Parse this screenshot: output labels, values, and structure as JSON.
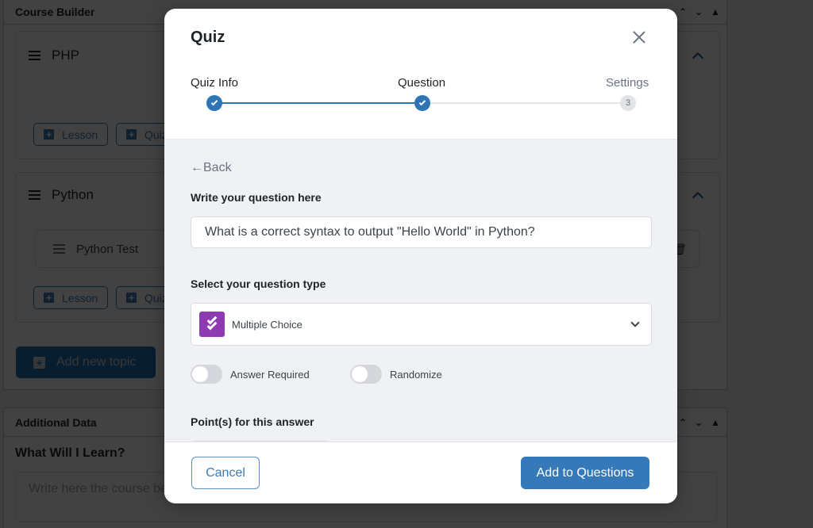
{
  "background": {
    "course_builder": {
      "title": "Course Builder",
      "topics": [
        {
          "name": "PHP",
          "items": [],
          "buttons": [
            "Lesson",
            "Quiz"
          ]
        },
        {
          "name": "Python",
          "items": [
            "Python Test"
          ],
          "buttons": [
            "Lesson",
            "Quiz"
          ]
        }
      ],
      "add_topic_label": "Add new topic"
    },
    "additional_data": {
      "title": "Additional Data",
      "section_heading": "What Will I Learn?",
      "textarea_placeholder": "Write here the course benefits"
    }
  },
  "modal": {
    "title": "Quiz",
    "steps": [
      {
        "label": "Quiz Info",
        "status": "done"
      },
      {
        "label": "Question",
        "status": "done"
      },
      {
        "label": "Settings",
        "status": "pending",
        "number": "3"
      }
    ],
    "back_label": "←Back",
    "question_label": "Write your question here",
    "question_value": "What is a correct syntax to output \"Hello World\" in Python?",
    "type_label": "Select your question type",
    "type_value": "Multiple Choice",
    "toggles": [
      {
        "label": "Answer Required",
        "on": false
      },
      {
        "label": "Randomize",
        "on": false
      }
    ],
    "points_label": "Point(s) for this answer",
    "cancel_label": "Cancel",
    "submit_label": "Add to Questions",
    "colors": {
      "accent": "#3579b8",
      "question_type_icon": "#8e3ab1"
    }
  }
}
